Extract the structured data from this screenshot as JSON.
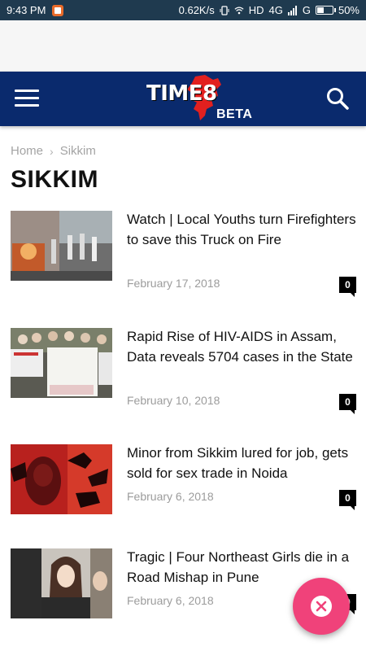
{
  "status_bar": {
    "time": "9:43 PM",
    "speed": "0.62K/s",
    "network": "HD",
    "signal": "4G",
    "signal2": "G",
    "battery": "50%",
    "battery_level": 0.5
  },
  "header": {
    "logo_text": "TIME8",
    "logo_badge": "BETA",
    "menu_icon": "hamburger-menu-icon",
    "search_icon": "search-icon",
    "background_color": "#0a2a6d"
  },
  "breadcrumb": {
    "home": "Home",
    "separator": "›",
    "current": "Sikkim"
  },
  "page_title": "SIKKIM",
  "articles": [
    {
      "title": "Watch | Local Youths turn Firefighters to save this Truck on Fire",
      "date": "February 17, 2018",
      "comments": "0"
    },
    {
      "title": "Rapid Rise of HIV-AIDS in Assam, Data reveals 5704 cases in the State",
      "date": "February 10, 2018",
      "comments": "0"
    },
    {
      "title": "Minor from Sikkim lured for job, gets sold for sex trade in Noida",
      "date": "February 6, 2018",
      "comments": "0"
    },
    {
      "title": "Tragic | Four Northeast Girls die in a Road Mishap in Pune",
      "date": "February 6, 2018",
      "comments": "0"
    }
  ],
  "fab": {
    "icon": "close-icon",
    "color": "#f0427a"
  }
}
